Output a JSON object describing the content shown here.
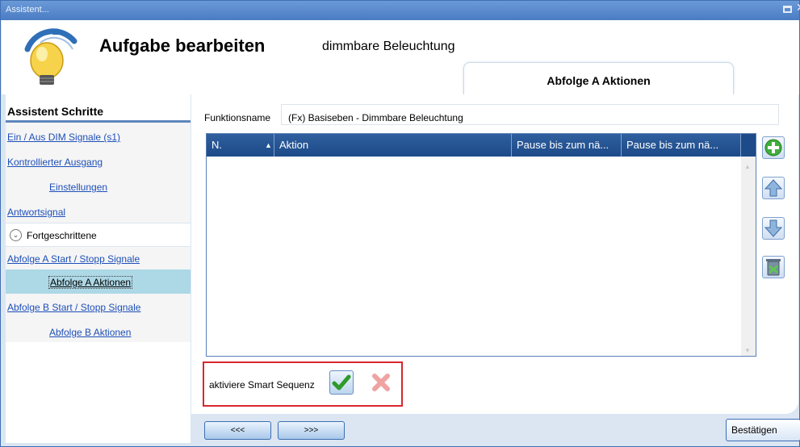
{
  "window": {
    "title": "Assistent..."
  },
  "header": {
    "title": "Aufgabe bearbeiten",
    "subtitle": "dimmbare Beleuchtung",
    "active_tab": "Abfolge A Aktionen"
  },
  "sidebar": {
    "caption": "Assistent Schritte",
    "items": [
      {
        "label": "Ein / Aus DIM Signale (s1)",
        "level": "top"
      },
      {
        "label": "Kontrollierter Ausgang",
        "level": "top"
      },
      {
        "label": "Einstellungen",
        "level": "sub"
      },
      {
        "label": "Antwortsignal",
        "level": "top"
      },
      {
        "label": "Fortgeschrittene",
        "level": "group"
      },
      {
        "label": "Abfolge A Start / Stopp Signale",
        "level": "top"
      },
      {
        "label": "Abfolge A Aktionen",
        "level": "sub",
        "active": true
      },
      {
        "label": "Abfolge B Start / Stopp Signale",
        "level": "top"
      },
      {
        "label": "Abfolge B Aktionen",
        "level": "sub"
      }
    ]
  },
  "form": {
    "function_name_label": "Funktionsname",
    "function_name_value": "(Fx) Basiseben - Dimmbare Beleuchtung"
  },
  "grid": {
    "columns": [
      "N.",
      "Aktion",
      "Pause bis zum nä...",
      "Pause bis zum nä..."
    ],
    "rows": []
  },
  "side_buttons": [
    "add-icon",
    "move-up-icon",
    "move-down-icon",
    "delete-icon"
  ],
  "smart_sequence": {
    "label": "aktiviere Smart Sequenz"
  },
  "footer": {
    "back_label": "<<<",
    "next_label": ">>>",
    "confirm_label": "Bestätigen"
  },
  "colors": {
    "accent": "#1d4a89",
    "link": "#1e4fb8",
    "highlight_border": "#d9262c",
    "active_step": "#add8e6"
  }
}
